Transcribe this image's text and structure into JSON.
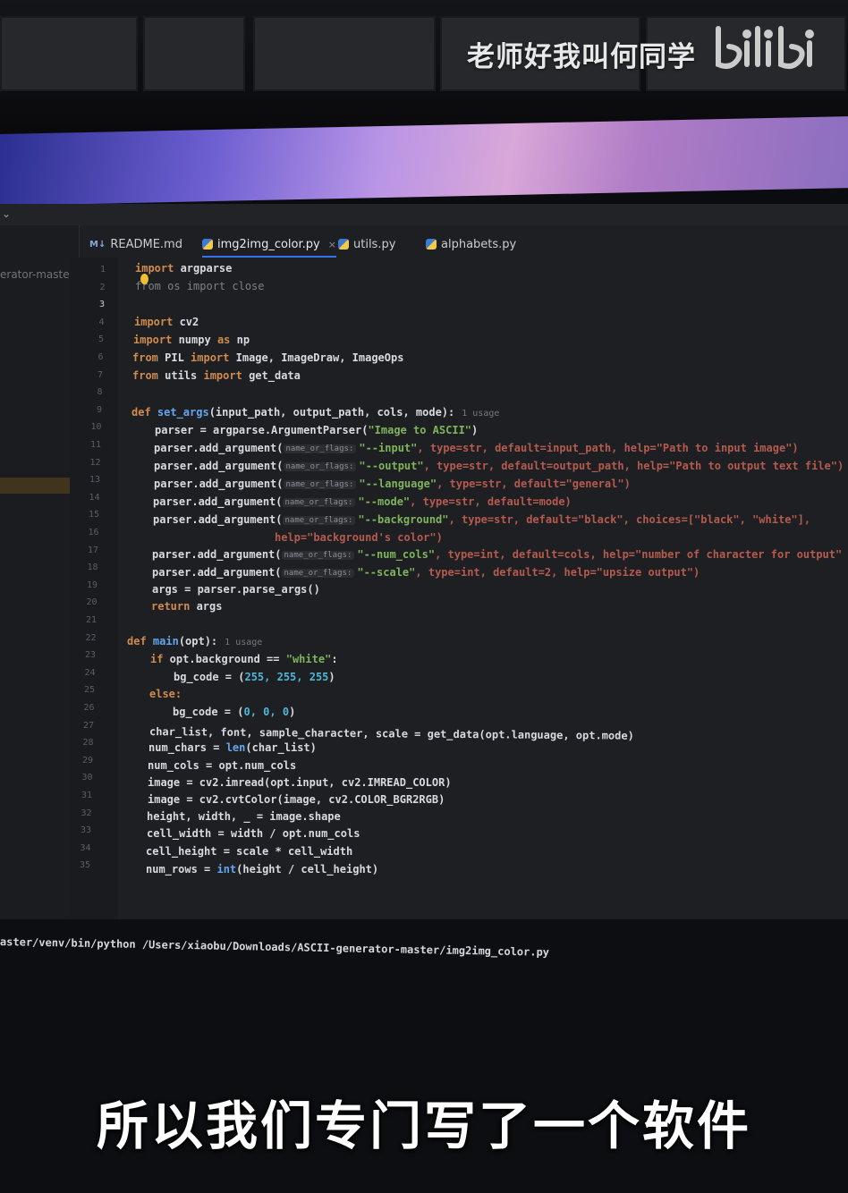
{
  "watermark": {
    "uploader": "老师好我叫何同学",
    "site": "bilibili"
  },
  "ide": {
    "sidebar_project": "erator-master",
    "tabs": [
      {
        "icon": "markdown-icon",
        "icon_text": "M↓",
        "label": "README.md",
        "active": false
      },
      {
        "icon": "python-icon",
        "label": "img2img_color.py",
        "active": true,
        "closable": "×"
      },
      {
        "icon": "python-icon",
        "label": "utils.py",
        "active": false
      },
      {
        "icon": "python-icon",
        "label": "alphabets.py",
        "active": false
      }
    ],
    "current_line": 3,
    "line_numbers": [
      "1",
      "2",
      "3",
      "4",
      "5",
      "6",
      "7",
      "8",
      "9",
      "10",
      "11",
      "12",
      "13",
      "14",
      "15",
      "16",
      "17",
      "18",
      "19",
      "20",
      "21",
      "22",
      "23",
      "24",
      "25",
      "26",
      "27",
      "28",
      "29",
      "30",
      "31",
      "32",
      "33",
      "34",
      "35"
    ],
    "hints": {
      "name_or_flags": "name_or_flags:",
      "usage": "1 usage"
    },
    "code": {
      "l1_kw": "import",
      "l1_rest": " argparse",
      "l2": "from os import close",
      "l4_kw": "import",
      "l4_rest": " cv2",
      "l5_kw1": "import",
      "l5_mid": " numpy ",
      "l5_kw2": "as",
      "l5_rest": " np",
      "l6_kw1": "from",
      "l6_mid": " PIL ",
      "l6_kw2": "import",
      "l6_rest": " Image, ImageDraw, ImageOps",
      "l7_kw1": "from",
      "l7_mid": " utils ",
      "l7_kw2": "import",
      "l7_rest": " get_data",
      "l9_kw": "def ",
      "l9_fn": "set_args",
      "l9_rest": "(input_path, output_path, cols, mode):",
      "l10_a": "parser = argparse.ArgumentParser(",
      "l10_s": "\"Image to ASCII\"",
      "l10_b": ")",
      "add_arg": "parser.add_argument(",
      "l11_s": "\"--input\"",
      "l11_rest": ", type=str, default=input_path, help=\"Path to input image\")",
      "l12_s": "\"--output\"",
      "l12_rest": ", type=str, default=output_path, help=\"Path to output text file\")",
      "l13_s": "\"--language\"",
      "l13_rest": ", type=str, default=\"general\")",
      "l14_s": "\"--mode\"",
      "l14_rest": ", type=str, default=mode)",
      "l15_s": "\"--background\"",
      "l15_rest": ", type=str, default=\"black\", choices=[\"black\", \"white\"],",
      "l16": "help=\"background's color\")",
      "l17_s": "\"--num_cols\"",
      "l17_rest": ", type=int, default=cols, help=\"number of character for output\"",
      "l18_s": "\"--scale\"",
      "l18_rest": ", type=int, default=2, help=\"upsize output\")",
      "l19": "args = parser.parse_args()",
      "l20_kw": "return",
      "l20_rest": " args",
      "l22_kw": "def ",
      "l22_fn": "main",
      "l22_rest": "(opt):",
      "l23_kw": "if",
      "l23_mid": " opt.background == ",
      "l23_s": "\"white\"",
      "l23_rest": ":",
      "l24_a": "bg_code = (",
      "l24_n": "255, 255, 255",
      "l24_b": ")",
      "l25_kw": "else:",
      "l26_a": "bg_code = (",
      "l26_n": "0, 0, 0",
      "l26_b": ")",
      "l27": "char_list, font, sample_character, scale = get_data(opt.language, opt.mode)",
      "l28_a": "num_chars = ",
      "l28_fn": "len",
      "l28_b": "(char_list)",
      "l29": "num_cols = opt.num_cols",
      "l30": "image = cv2.imread(opt.input, cv2.IMREAD_COLOR)",
      "l31": "image = cv2.cvtColor(image, cv2.COLOR_BGR2RGB)",
      "l32": "height, width, _ = image.shape",
      "l33": "cell_width = width / opt.num_cols",
      "l34": "cell_height = scale * cell_width",
      "l35_a": "num_rows = ",
      "l35_fn": "int",
      "l35_b": "(height / cell_height)"
    }
  },
  "terminal": {
    "command": "aster/venv/bin/python /Users/xiaobu/Downloads/ASCII-generator-master/img2img_color.py"
  },
  "subtitle": "所以我们专门写了一个软件",
  "colors": {
    "keyword": "#d08b4e",
    "function": "#63a5ee",
    "string": "#7fb45c",
    "number": "#4fb6d8",
    "tab_accent": "#3574f0"
  }
}
